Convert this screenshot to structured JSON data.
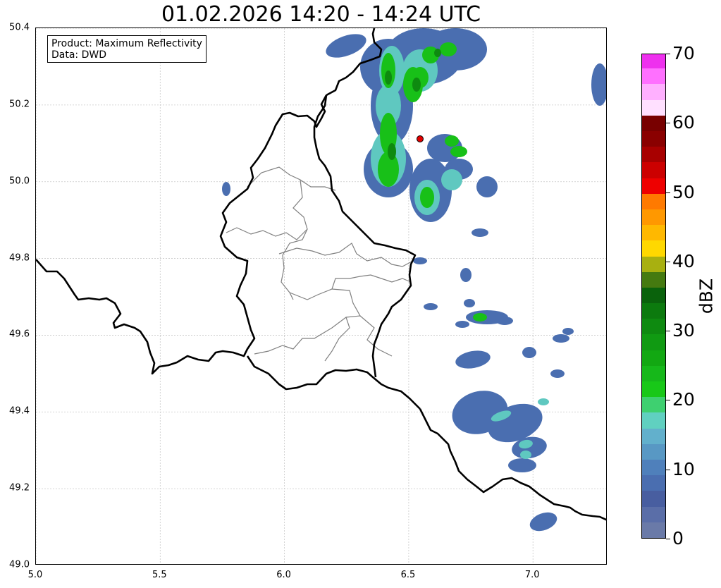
{
  "title": "01.02.2026 14:20 - 14:24 UTC",
  "info_box": {
    "line1": "Product: Maximum Reflectivity",
    "line2": "Data: DWD"
  },
  "map": {
    "lon_range": [
      5.0,
      7.3
    ],
    "lat_range": [
      49.0,
      50.4
    ],
    "lon_ticks": [
      "5.0",
      "5.5",
      "6.0",
      "6.5",
      "7.0"
    ],
    "lat_ticks": [
      "49.0",
      "49.2",
      "49.4",
      "49.6",
      "49.8",
      "50.0",
      "50.2",
      "50.4"
    ],
    "grid": true,
    "radar_site_color": "#e00000",
    "border_color": "#000000",
    "canton_color": "#808080"
  },
  "colorbar": {
    "label": "dBZ",
    "ticks": [
      "0",
      "10",
      "20",
      "30",
      "40",
      "50",
      "60",
      "70"
    ],
    "range": [
      0,
      70
    ],
    "colors": [
      "#6a7aa8",
      "#5a6ea8",
      "#485ea0",
      "#4a6eb0",
      "#4f80bb",
      "#5898c4",
      "#62b0cc",
      "#60d0c0",
      "#3ed070",
      "#18c818",
      "#16b81a",
      "#12a812",
      "#109a12",
      "#0e8a10",
      "#0c7a0e",
      "#0a620c",
      "#457a10",
      "#a8b010",
      "#ffd800",
      "#ffb800",
      "#ff9800",
      "#ff7a00",
      "#ee0000",
      "#cc0000",
      "#a80000",
      "#8a0000",
      "#780000",
      "#ffe0ff",
      "#ffb0ff",
      "#ff70ff",
      "#ee30ee"
    ]
  }
}
